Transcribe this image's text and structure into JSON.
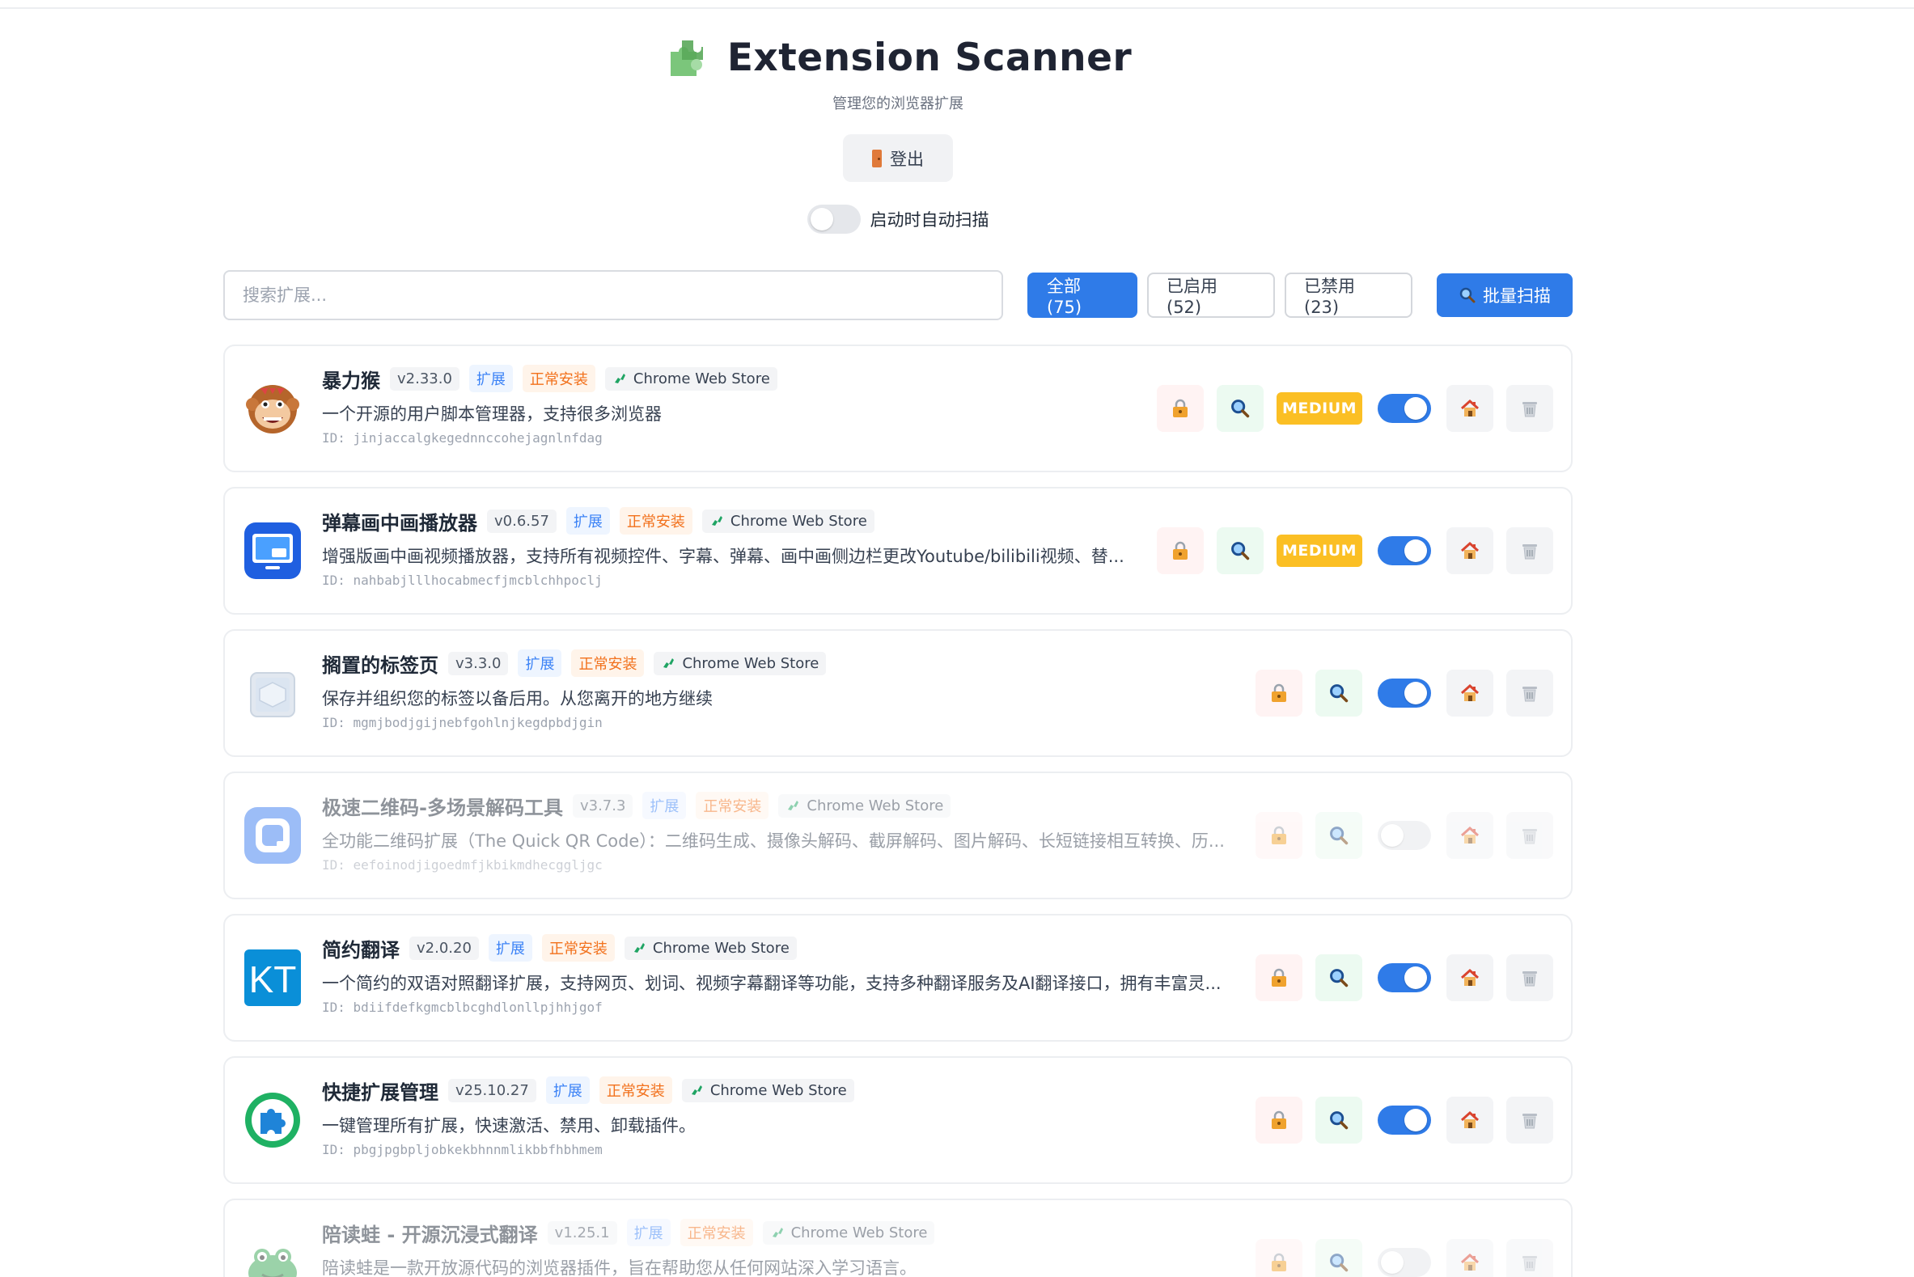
{
  "app": {
    "title": "Extension Scanner",
    "subtitle": "管理您的浏览器扩展",
    "logout_label": "登出",
    "auto_scan_label": "启动时自动扫描",
    "auto_scan_on": false
  },
  "toolbar": {
    "search_placeholder": "搜索扩展...",
    "search_value": "",
    "filters": [
      {
        "label": "全部 (75)",
        "active": true
      },
      {
        "label": "已启用 (52)",
        "active": false
      },
      {
        "label": "已禁用 (23)",
        "active": false
      }
    ],
    "batch_scan_label": "批量扫描"
  },
  "colors": {
    "accent": "#2f7be8",
    "risk_medium": "#fbbf24",
    "install_tag": "#f2711c",
    "kind_tag": "#3b82f6"
  },
  "extensions": [
    {
      "name": "暴力猴",
      "version": "v2.33.0",
      "kind": "扩展",
      "install": "正常安装",
      "store": "Chrome Web Store",
      "description": "一个开源的用户脚本管理器，支持很多浏览器",
      "id": "ID: jinjaccalgkegednnccohejagnlnfdag",
      "enabled": true,
      "risk": "MEDIUM",
      "icon": "monkey-icon"
    },
    {
      "name": "弹幕画中画播放器",
      "version": "v0.6.57",
      "kind": "扩展",
      "install": "正常安装",
      "store": "Chrome Web Store",
      "description": "增强版画中画视频播放器，支持所有视频控件、字幕、弹幕、画中画侧边栏更改Youtube/bilibili视频、替...",
      "id": "ID: nahbabjlllhocabmecfjmcblchhpoclj",
      "enabled": true,
      "risk": "MEDIUM",
      "icon": "pip-player-icon"
    },
    {
      "name": "搁置的标签页",
      "version": "v3.3.0",
      "kind": "扩展",
      "install": "正常安装",
      "store": "Chrome Web Store",
      "description": "保存并组织您的标签以备后用。从您离开的地方继续",
      "id": "ID: mgmjbodjgijnebfgohlnjkegdpbdjgin",
      "enabled": true,
      "risk": "",
      "icon": "box-icon"
    },
    {
      "name": "极速二维码-多场景解码工具",
      "version": "v3.7.3",
      "kind": "扩展",
      "install": "正常安装",
      "store": "Chrome Web Store",
      "description": "全功能二维码扩展（The Quick QR Code）：二维码生成、摄像头解码、截屏解码、图片解码、长短链接相互转换、历...",
      "id": "ID: eefoinodjigoedmfjkbikmdhecggljgc",
      "enabled": false,
      "risk": "",
      "icon": "qr-icon"
    },
    {
      "name": "简约翻译",
      "version": "v2.0.20",
      "kind": "扩展",
      "install": "正常安装",
      "store": "Chrome Web Store",
      "description": "一个简约的双语对照翻译扩展，支持网页、划词、视频字幕翻译等功能，支持多种翻译服务及AI翻译接口，拥有丰富灵...",
      "id": "ID: bdiifdefkgmcblbcghdlonllpjhhjgof",
      "enabled": true,
      "risk": "",
      "icon": "kt-icon"
    },
    {
      "name": "快捷扩展管理",
      "version": "v25.10.27",
      "kind": "扩展",
      "install": "正常安装",
      "store": "Chrome Web Store",
      "description": "一键管理所有扩展，快速激活、禁用、卸载插件。",
      "id": "ID: pbgjpgbpljobkekbhnnmlikbbfhbhmem",
      "enabled": true,
      "risk": "",
      "icon": "puzzle-icon"
    },
    {
      "name": "陪读蛙 - 开源沉浸式翻译",
      "version": "v1.25.1",
      "kind": "扩展",
      "install": "正常安装",
      "store": "Chrome Web Store",
      "description": "陪读蛙是一款开放源代码的浏览器插件，旨在帮助您从任何网站深入学习语言。",
      "id": "",
      "enabled": false,
      "risk": "",
      "icon": "frog-icon"
    }
  ]
}
